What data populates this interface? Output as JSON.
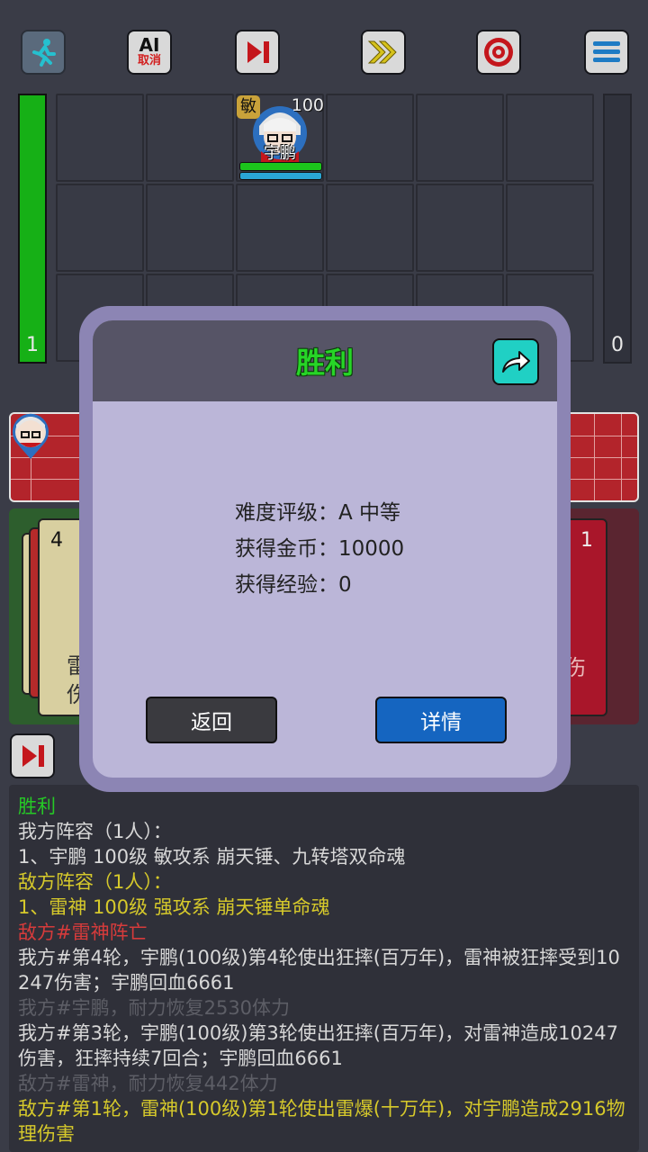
{
  "topbar": {
    "ai_label_top": "AI",
    "ai_label_bottom": "取消"
  },
  "left_bar": {
    "value": "1"
  },
  "right_bar": {
    "value": "0"
  },
  "hero_unit": {
    "name": "宇鹏",
    "badge": "敏",
    "level": "100"
  },
  "cards": {
    "left_count": "4",
    "left_text_1": "雷",
    "left_text_2": "伤",
    "right_count": "1",
    "right_text": "伤"
  },
  "dialog": {
    "title": "胜利",
    "difficulty": "难度评级：A 中等",
    "coins": "获得金币：10000",
    "exp": "获得经验：0",
    "back_label": "返回",
    "details_label": "详情"
  },
  "log": {
    "lines": [
      {
        "text": "胜利",
        "color": "#26c926"
      },
      {
        "text": "我方阵容（1人）：",
        "color": "#d8d8d8"
      },
      {
        "text": "1、宇鹏 100级 敏攻系 崩天锤、九转塔双命魂",
        "color": "#d8d8d8"
      },
      {
        "text": "敌方阵容（1人）：",
        "color": "#d6c92b"
      },
      {
        "text": "1、雷神 100级 强攻系 崩天锤单命魂",
        "color": "#d6c92b"
      },
      {
        "text": "敌方#雷神阵亡",
        "color": "#d63b3b"
      },
      {
        "text": "我方#第4轮，宇鹏(100级)第4轮使出狂摔(百万年)，雷神被狂摔受到10247伤害；宇鹏回血6661",
        "color": "#d8d8d8"
      },
      {
        "text": "我方#宇鹏，耐力恢复2530体力",
        "color": "#5d5e66"
      },
      {
        "text": "我方#第3轮，宇鹏(100级)第3轮使出狂摔(百万年)，对雷神造成10247伤害，狂摔持续7回合；宇鹏回血6661",
        "color": "#d8d8d8"
      },
      {
        "text": "敌方#雷神，耐力恢复442体力",
        "color": "#5d5e66"
      },
      {
        "text": "敌方#第1轮，雷神(100级)第1轮使出雷爆(十万年)，对宇鹏造成2916物理伤害",
        "color": "#d6c92b"
      }
    ]
  }
}
